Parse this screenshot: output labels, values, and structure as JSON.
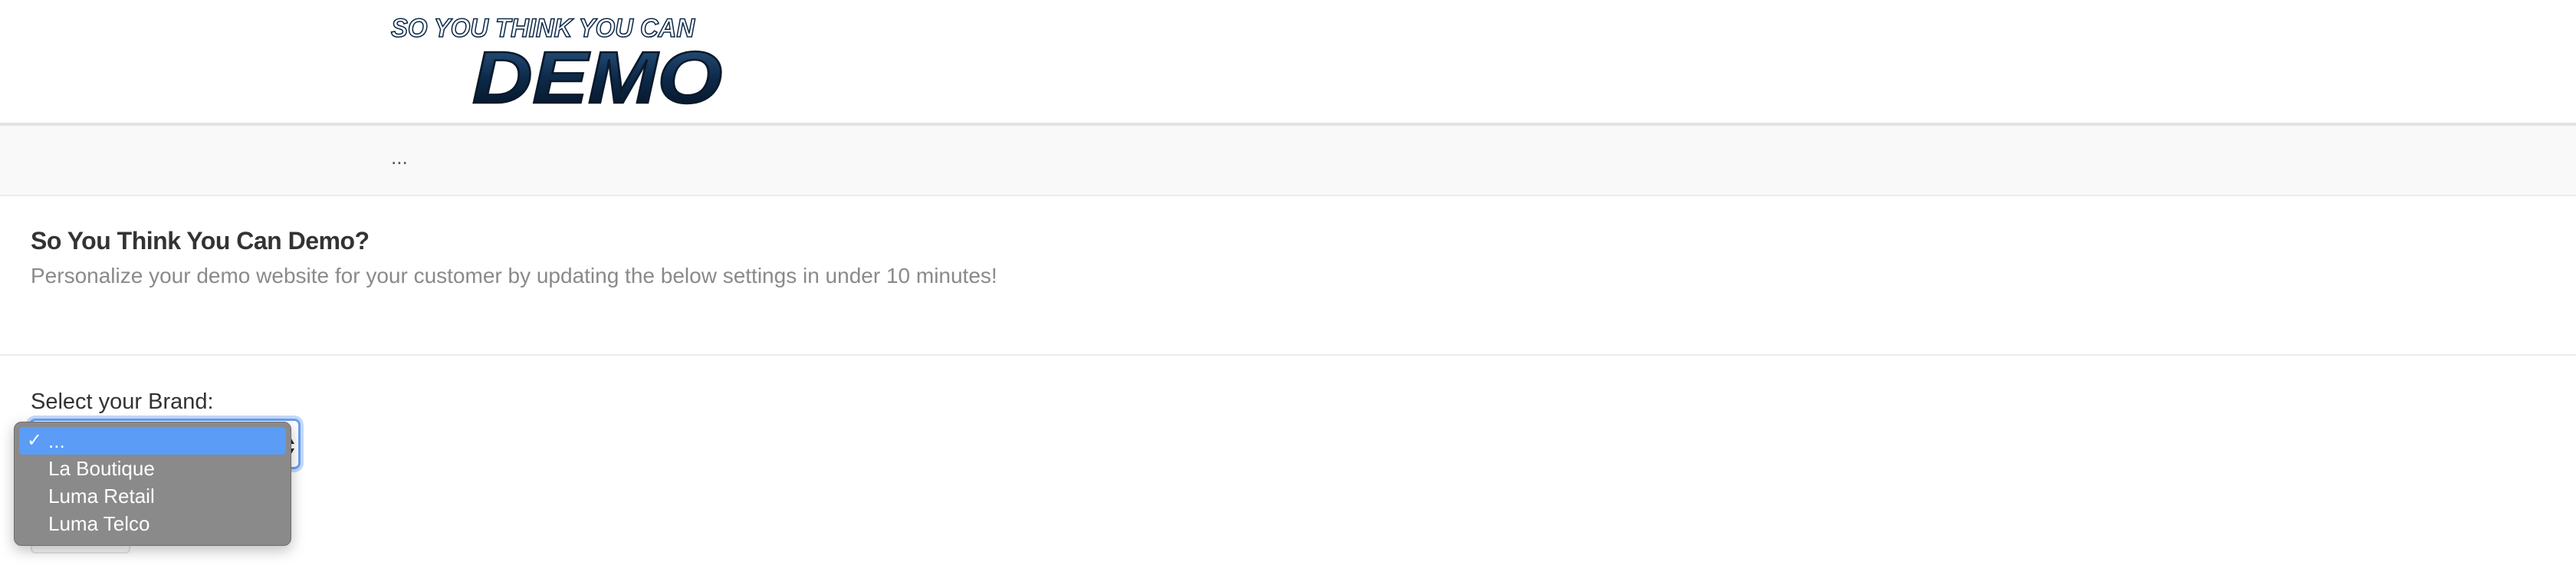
{
  "header": {
    "logo_top_text": "SO YOU THINK YOU CAN",
    "logo_main_text": "DEMO"
  },
  "breadcrumb": {
    "text": "..."
  },
  "intro": {
    "title": "So You Think You Can Demo?",
    "subtitle": "Personalize your demo website for your customer by updating the below settings in under 10 minutes!"
  },
  "brand_select": {
    "label": "Select your Brand:",
    "selected_value": "...",
    "options": [
      {
        "label": "...",
        "selected": true
      },
      {
        "label": "La Boutique",
        "selected": false
      },
      {
        "label": "Luma Retail",
        "selected": false
      },
      {
        "label": "Luma Telco",
        "selected": false
      }
    ]
  },
  "icons": {
    "checkmark": "check-icon",
    "select_arrows": "updown-arrows-icon"
  },
  "colors": {
    "highlight": "#5a9cf6",
    "dropdown_bg": "#8a8a8a",
    "logo_dark": "#0d2a4a",
    "focus_ring": "#6aa0f0"
  }
}
